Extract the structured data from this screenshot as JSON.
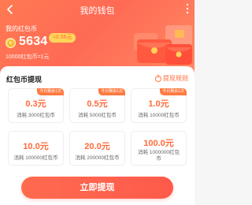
{
  "topbar": {
    "title": "我的钱包"
  },
  "wallet": {
    "label": "我的红包币",
    "balance": "5634",
    "balance_value": "≈0.56元",
    "rate": "10000红包币=1元"
  },
  "withdraw": {
    "section_title": "红包币提现",
    "rules_label": "提现规则",
    "options": [
      {
        "badge": "今日剩余1次",
        "amount": "0.3元",
        "cost": "消耗 3000红包币"
      },
      {
        "badge": "今日剩余1次",
        "amount": "0.5元",
        "cost": "消耗 5000红包币"
      },
      {
        "badge": "今日剩余1次",
        "amount": "1.0元",
        "cost": "消耗 10000红包币"
      },
      {
        "amount": "10.0元",
        "cost": "消耗 100000红包币"
      },
      {
        "amount": "20.0元",
        "cost": "消耗 200000红包币"
      },
      {
        "amount": "100.0元",
        "cost": "消耗 1000000红包币"
      }
    ],
    "button_label": "立即提现"
  },
  "colors": {
    "accent": "#ff6a3a",
    "header": "#ff7a52",
    "button": "#ff5a4c"
  },
  "icons": [
    "back-arrow-icon",
    "more-vertical-icon",
    "coin-icon",
    "info-icon",
    "red-envelope-illustration"
  ]
}
